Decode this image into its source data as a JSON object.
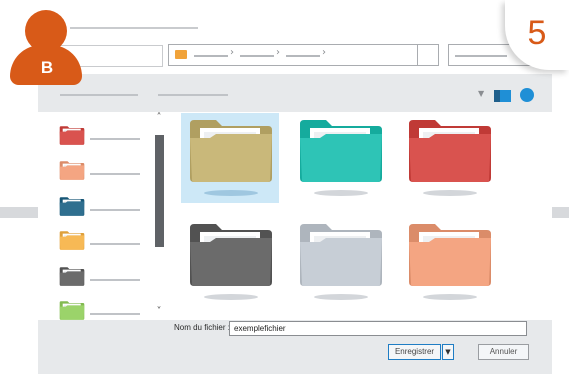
{
  "avatar": {
    "letter": "B",
    "color": "#d85a18"
  },
  "step_badge": {
    "number": "5",
    "color": "#d85a18"
  },
  "address_bar": {
    "icon": "folder-icon",
    "crumbs": [
      "",
      "",
      ""
    ]
  },
  "toolbar": {
    "view_icon": "view-mode-icon",
    "help_icon": "help-icon"
  },
  "nav_folders": [
    {
      "color": "#d9534f",
      "icon": "folder-icon"
    },
    {
      "color": "#f4a582",
      "icon": "folder-icon"
    },
    {
      "color": "#2f6f8f",
      "icon": "folder-icon"
    },
    {
      "color": "#f7b955",
      "icon": "folder-icon"
    },
    {
      "color": "#6b6b6b",
      "icon": "folder-icon"
    },
    {
      "color": "#9bd36a",
      "icon": "folder-icon"
    }
  ],
  "content_folders": [
    {
      "color": "#c9b87a",
      "selected": true
    },
    {
      "color": "#2ec4b6",
      "selected": false
    },
    {
      "color": "#d9534f",
      "selected": false
    },
    {
      "color": "#6b6b6b",
      "selected": false
    },
    {
      "color": "#c7ced6",
      "selected": false
    },
    {
      "color": "#f4a582",
      "selected": false
    }
  ],
  "file_name": {
    "label": "Nom du fichier :",
    "value": "exemplefichier"
  },
  "buttons": {
    "save": "Enregistrer",
    "cancel": "Annuler"
  }
}
